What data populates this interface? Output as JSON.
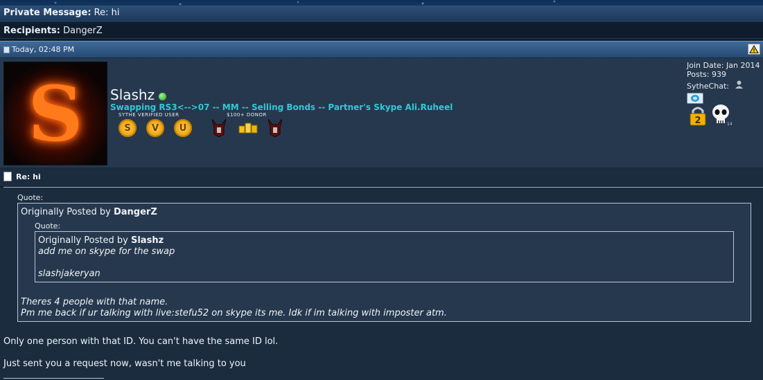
{
  "window": {
    "title_label": "Private Message",
    "title_value": "Re: hi"
  },
  "recipients": {
    "label": "Recipients",
    "value": "DangerZ"
  },
  "post": {
    "date": "Today, 02:48 PM",
    "report_icon": "warning-triangle-icon"
  },
  "user": {
    "avatar_letter": "S",
    "name": "Slashz",
    "online": true,
    "title": "Swapping RS3<-->07 -- MM -- Selling Bonds -- Partner's Skype Ali.Ruheel",
    "badge_caption_1": "SYTHE VERIFIED USER",
    "badge_caption_2": "$100+ DONOR",
    "badges": [
      "S",
      "V",
      "U"
    ],
    "join_date": "Join Date: Jan 2014",
    "posts": "Posts: 939",
    "sythechat": "SytheChat:",
    "lock_number": "2",
    "skull_number": "14"
  },
  "message": {
    "title": "Re: hi",
    "outer_quote_label": "Quote:",
    "outer_quote_prefix": "Originally Posted by",
    "outer_quote_author": "DangerZ",
    "inner_quote_label": "Quote:",
    "inner_quote_prefix": "Originally Posted by",
    "inner_quote_author": "Slashz",
    "inner_quote_line1": "add me on skype for the swap",
    "inner_quote_line2": "slashjakeryan",
    "outer_line1": "Theres 4 people with that name.",
    "outer_line2": "Pm me back if ur talking with live:stefu52 on skype its me. Idk if im talking with imposter atm.",
    "reply_line1": "Only one person with that ID. You can't have the same ID lol.",
    "reply_line2": "Just sent you a request now, wasn't me talking to you"
  },
  "colors": {
    "usertitle": "#31c8d8",
    "online": "#22a51a",
    "background": "#1b2c3f"
  }
}
